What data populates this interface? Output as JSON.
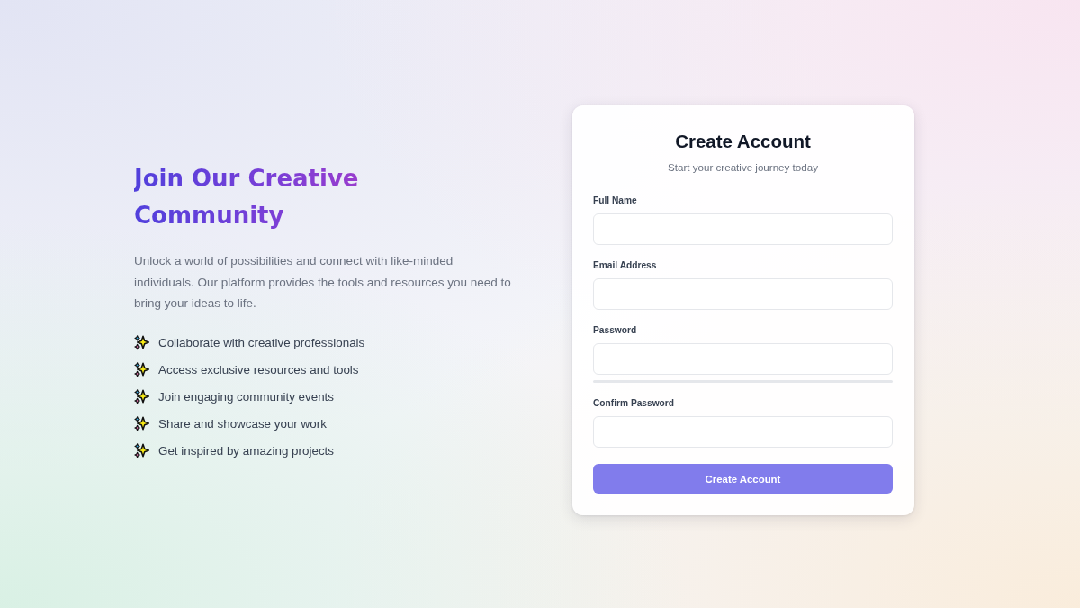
{
  "hero": {
    "heading": "Join Our Creative Community",
    "description": "Unlock a world of possibilities and connect with like-minded individuals. Our platform provides the tools and resources you need to bring your ideas to life.",
    "features": [
      "Collaborate with creative professionals",
      "Access exclusive resources and tools",
      "Join engaging community events",
      "Share and showcase your work",
      "Get inspired by amazing projects"
    ]
  },
  "signup_form": {
    "title": "Create Account",
    "subtitle": "Start your creative journey today",
    "fields": [
      {
        "label": "Full Name"
      },
      {
        "label": "Email Address"
      },
      {
        "label": "Password",
        "strength_meter": {
          "level": 0
        }
      },
      {
        "label": "Confirm Password"
      }
    ],
    "submit_button": "Create Account"
  }
}
